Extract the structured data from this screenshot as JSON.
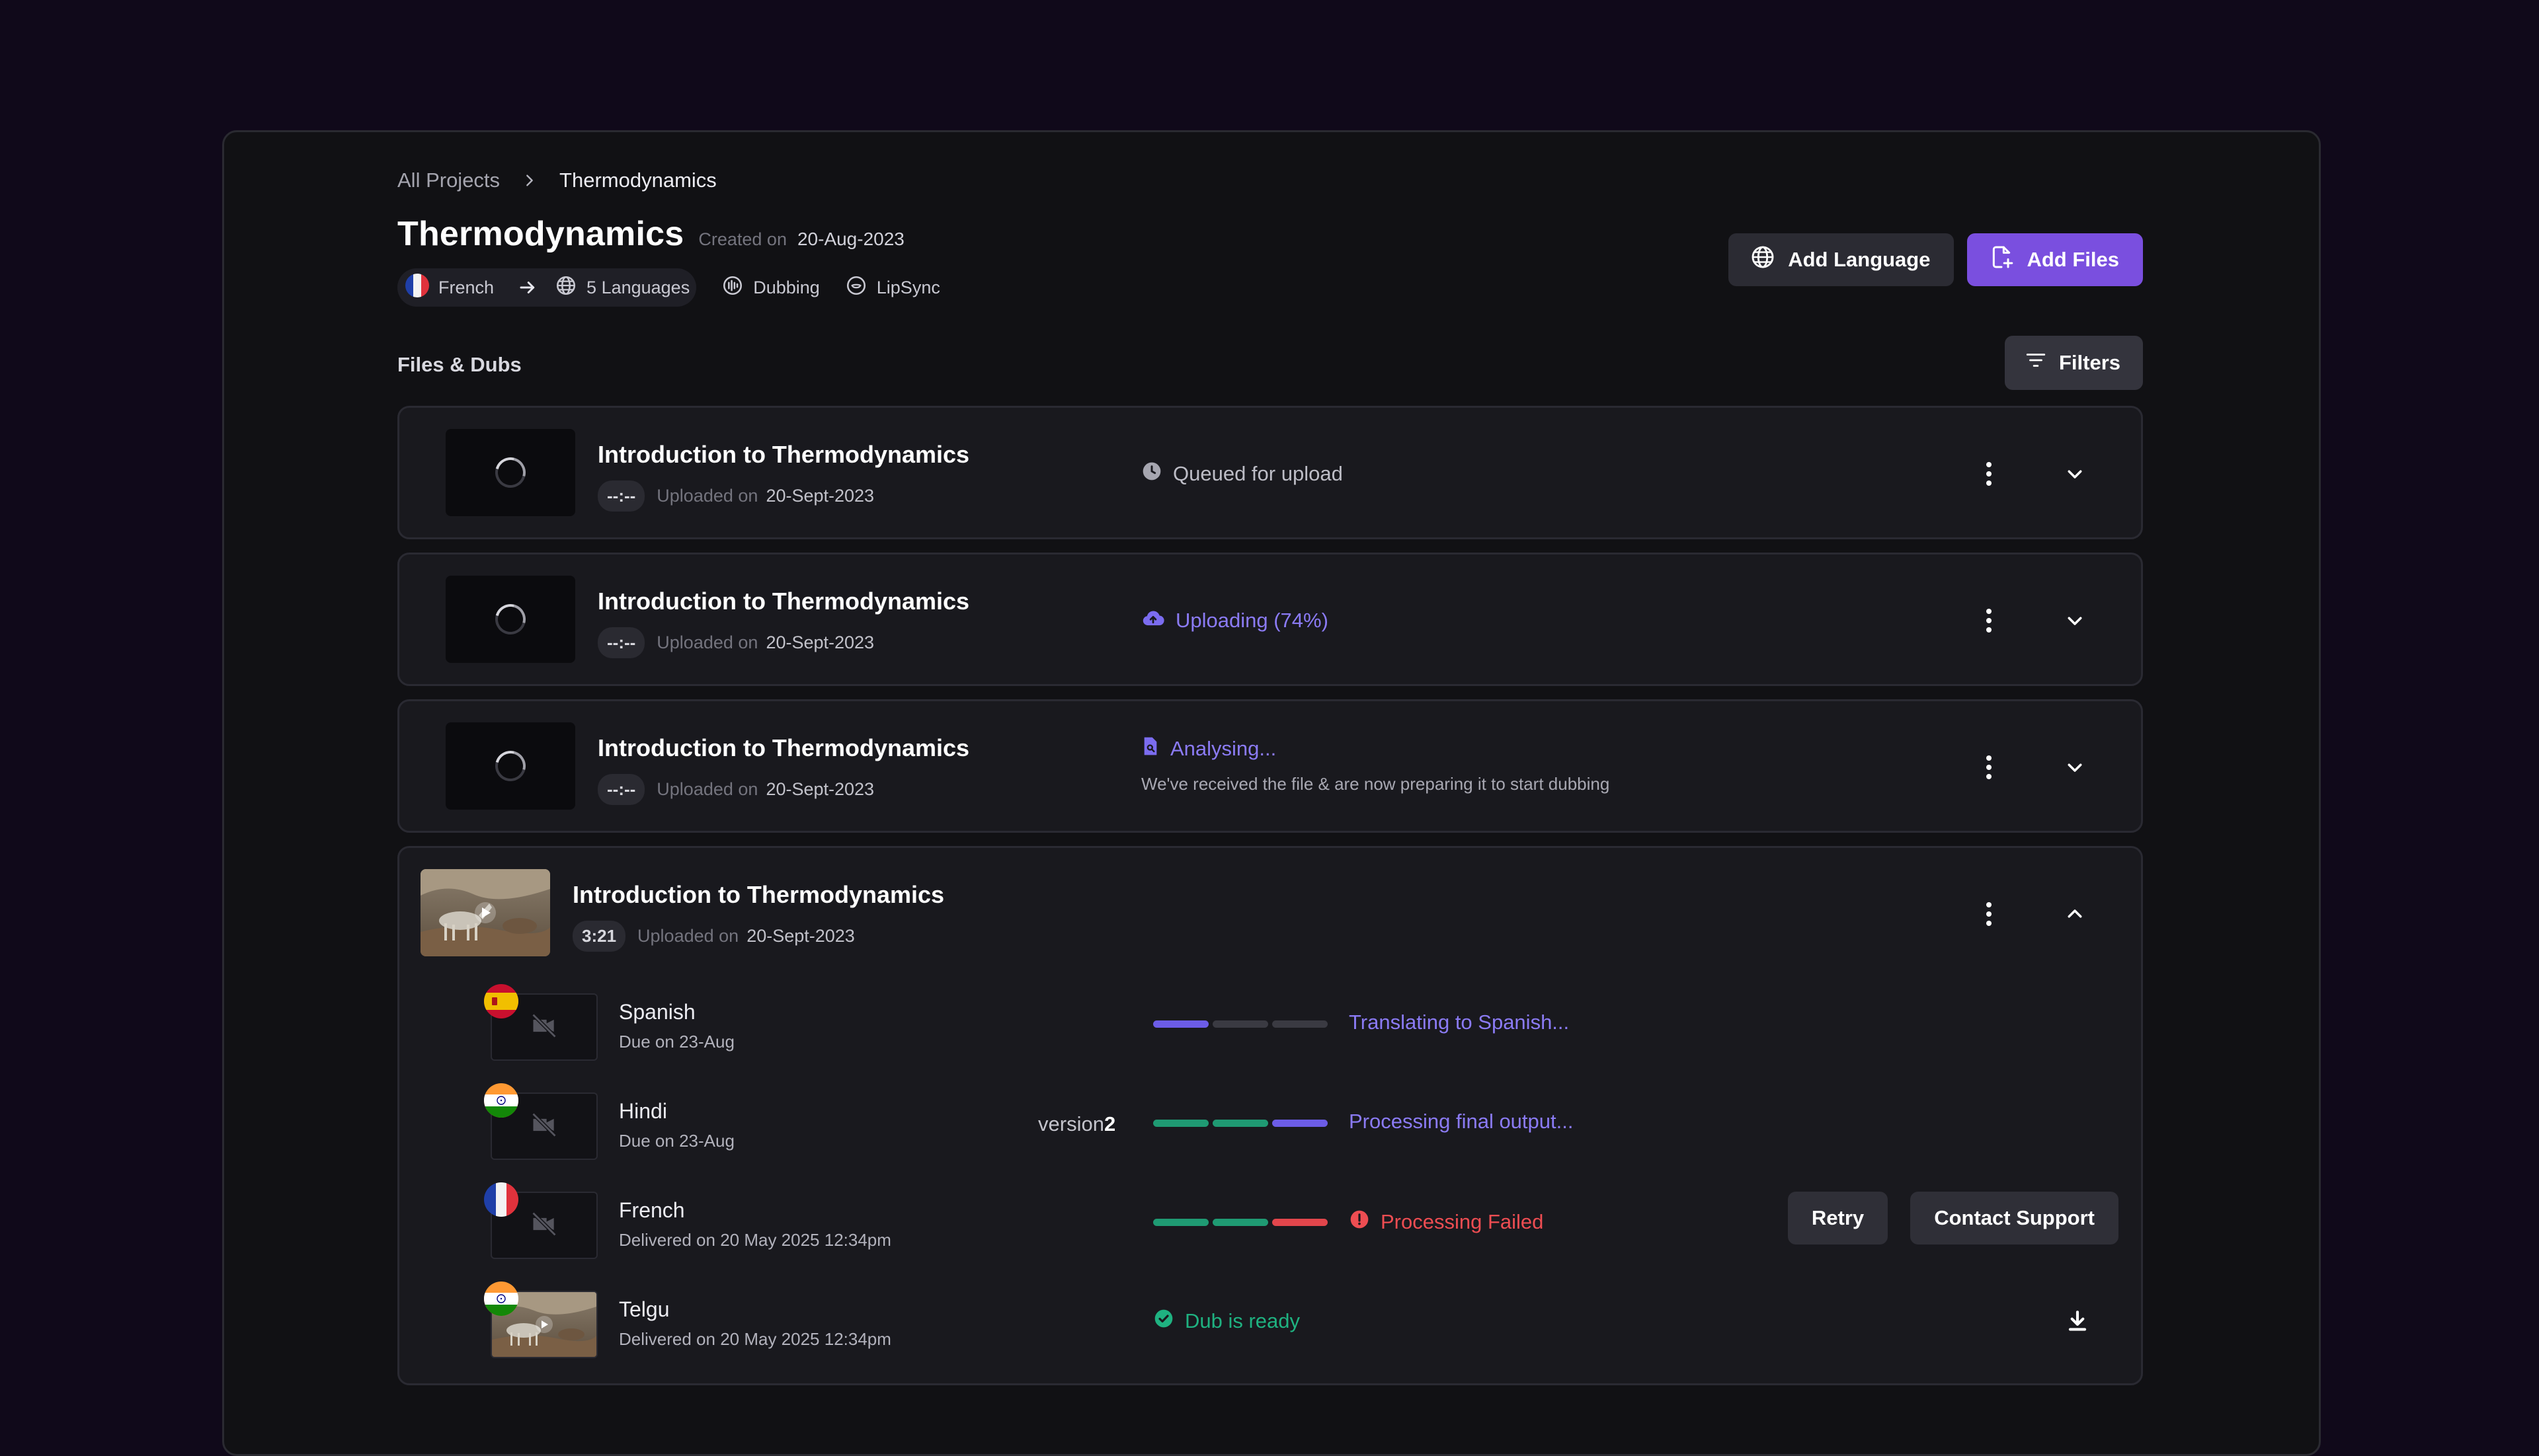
{
  "breadcrumb": {
    "root": "All Projects",
    "current": "Thermodynamics"
  },
  "project": {
    "title": "Thermodynamics",
    "created_label": "Created on",
    "created_date": "20-Aug-2023",
    "source_language": "French",
    "languages": "5 Languages",
    "features": [
      "Dubbing",
      "LipSync"
    ]
  },
  "actions": {
    "add_language": "Add Language",
    "add_files": "Add Files"
  },
  "section": {
    "title": "Files & Dubs",
    "filters": "Filters"
  },
  "files": [
    {
      "title": "Introduction to Thermodynamics",
      "duration": "--:--",
      "uploaded_label": "Uploaded on",
      "uploaded_date": "20-Sept-2023",
      "status": "Queued for upload"
    },
    {
      "title": "Introduction to Thermodynamics",
      "duration": "--:--",
      "uploaded_label": "Uploaded on",
      "uploaded_date": "20-Sept-2023",
      "status": "Uploading (74%)",
      "progress_percent": 74
    },
    {
      "title": "Introduction to Thermodynamics",
      "duration": "--:--",
      "uploaded_label": "Uploaded on",
      "uploaded_date": "20-Sept-2023",
      "status": "Analysing...",
      "note": "We've received the file & are now preparing it to start dubbing"
    },
    {
      "title": "Introduction to Thermodynamics",
      "duration": "3:21",
      "uploaded_label": "Uploaded on",
      "uploaded_date": "20-Sept-2023",
      "dubs": [
        {
          "language": "Spanish",
          "due": "Due on 23-Aug",
          "status": "Translating to Spanish...",
          "steps_complete": 1
        },
        {
          "language": "Hindi",
          "due": "Due on 23-Aug",
          "version_label": "version",
          "version_number": "2",
          "status": "Processing final output...",
          "steps_complete": 3
        },
        {
          "language": "French",
          "due": "Delivered on 20 May 2025 12:34pm",
          "status": "Processing Failed",
          "retry": "Retry",
          "contact": "Contact Support"
        },
        {
          "language": "Telgu",
          "due": "Delivered on 20 May 2025 12:34pm",
          "status": "Dub is ready"
        }
      ]
    }
  ],
  "colors": {
    "accent": "#7a4fdf",
    "progress": "#6c5ce7",
    "success": "#1f9a73",
    "error": "#e2464c",
    "background": "#10091a"
  }
}
